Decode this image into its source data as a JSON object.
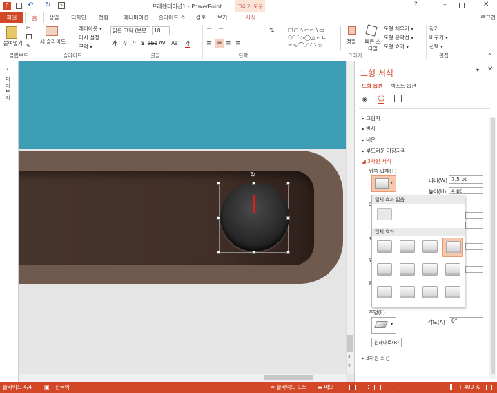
{
  "window": {
    "title": "프레젠테이션1 - PowerPoint",
    "tool_context": "그리기 도구",
    "signin": "로그인",
    "qa_num": "5"
  },
  "tabs": {
    "file": "파일",
    "home": "홈",
    "insert": "삽입",
    "design": "디자인",
    "transitions": "전환",
    "animations": "애니메이션",
    "slideshow": "슬라이드 쇼",
    "review": "검토",
    "view": "보기",
    "format": "서식"
  },
  "ribbon": {
    "clipboard": {
      "paste": "붙여넣기",
      "label": "클립보드"
    },
    "slides": {
      "new_slide": "새 슬라이드",
      "layout": "레이아웃 ▾",
      "reset": "다시 설정",
      "section": "구역 ▾",
      "label": "슬라이드"
    },
    "font": {
      "name": "맑은 고딕 (본문",
      "size": "18",
      "label": "글꼴",
      "bold": "가",
      "italic": "가",
      "underline": "가",
      "strike": "abc",
      "shadow": "S",
      "spacing": "AV",
      "case": "Aa",
      "color": "가"
    },
    "paragraph": {
      "label": "단락"
    },
    "drawing": {
      "arrange": "정렬",
      "quick_styles": "빠른 스타일",
      "fill": "도형 채우기 ▾",
      "outline": "도형 윤곽선 ▾",
      "effects": "도형 효과 ▾",
      "label": "그리기"
    },
    "editing": {
      "find": "찾기",
      "replace": "바꾸기 ▾",
      "select": "선택 ▾",
      "label": "편집"
    }
  },
  "thumbs": {
    "label": "미리 보기"
  },
  "pane": {
    "title": "도형 서식",
    "tab_shape": "도형 옵션",
    "tab_text": "텍스트 옵션",
    "sections": [
      "그림자",
      "반사",
      "네온",
      "부드러운 가장자리",
      "3차원 서식"
    ],
    "top_bevel": "위쪽 입체(T)",
    "width_label": "너비(W)",
    "width_value": "7.5 pt",
    "height_label": "높이(H)",
    "height_value": "4 pt",
    "dropdown": {
      "none_header": "입체 효과 없음",
      "bevel_header": "입체 효과"
    },
    "left_labels": [
      "아",
      "깊",
      "외",
      "재"
    ],
    "lighting_label": "조명(L)",
    "angle_label": "각도(A)",
    "angle_value": "0°",
    "reset_button": "원래대로(R)",
    "rotation_section": "3차원 회전"
  },
  "status": {
    "slide": "슬라이드 4/4",
    "language": "한국어",
    "notes": "슬라이드 노트",
    "comments": "메모",
    "zoom": "400 %"
  }
}
